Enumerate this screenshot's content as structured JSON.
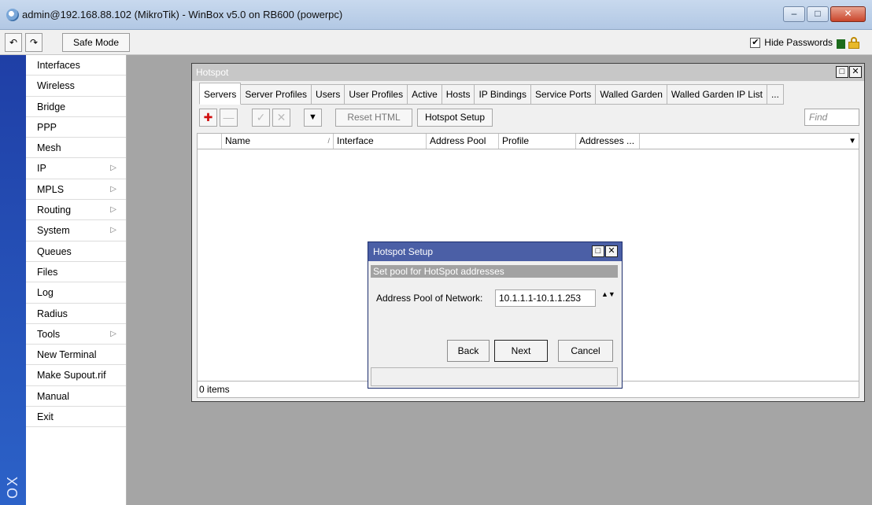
{
  "window": {
    "title": "admin@192.168.88.102 (MikroTik) - WinBox v5.0 on RB600 (powerpc)",
    "controls": {
      "minimize": "–",
      "maximize": "□",
      "close": "✕"
    }
  },
  "toolbar": {
    "undo_icon": "↶",
    "redo_icon": "↷",
    "safe_mode_label": "Safe Mode",
    "hide_passwords_label": "Hide Passwords",
    "hide_passwords_checked": "✔"
  },
  "strip": {
    "label": "OX"
  },
  "menu": {
    "items": [
      {
        "label": "Interfaces",
        "arrow": ""
      },
      {
        "label": "Wireless",
        "arrow": ""
      },
      {
        "label": "Bridge",
        "arrow": ""
      },
      {
        "label": "PPP",
        "arrow": ""
      },
      {
        "label": "Mesh",
        "arrow": ""
      },
      {
        "label": "IP",
        "arrow": "▷"
      },
      {
        "label": "MPLS",
        "arrow": "▷"
      },
      {
        "label": "Routing",
        "arrow": "▷"
      },
      {
        "label": "System",
        "arrow": "▷"
      },
      {
        "label": "Queues",
        "arrow": ""
      },
      {
        "label": "Files",
        "arrow": ""
      },
      {
        "label": "Log",
        "arrow": ""
      },
      {
        "label": "Radius",
        "arrow": ""
      },
      {
        "label": "Tools",
        "arrow": "▷"
      },
      {
        "label": "New Terminal",
        "arrow": ""
      },
      {
        "label": "Make Supout.rif",
        "arrow": ""
      },
      {
        "label": "Manual",
        "arrow": ""
      },
      {
        "label": "Exit",
        "arrow": ""
      }
    ]
  },
  "hotspot": {
    "title": "Hotspot",
    "tabs": [
      "Servers",
      "Server Profiles",
      "Users",
      "User Profiles",
      "Active",
      "Hosts",
      "IP Bindings",
      "Service Ports",
      "Walled Garden",
      "Walled Garden IP List",
      "..."
    ],
    "active_tab": "Servers",
    "toolbar": {
      "add_icon": "✚",
      "remove_icon": "—",
      "enable_icon": "✓",
      "disable_icon": "✕",
      "filter_icon": "▼",
      "reset_html_label": "Reset HTML",
      "hotspot_setup_label": "Hotspot Setup",
      "find_placeholder": "Find"
    },
    "table": {
      "columns": [
        "Name",
        "Interface",
        "Address Pool",
        "Profile",
        "Addresses ..."
      ],
      "sort_indicator": "/",
      "dropdown_arrow": "▼",
      "rows": []
    },
    "status": "0 items"
  },
  "setup_dialog": {
    "title": "Hotspot Setup",
    "header": "Set pool for HotSpot addresses",
    "field_label": "Address Pool of Network:",
    "field_value": "10.1.1.1-10.1.1.253",
    "spinner": "▲▼",
    "buttons": {
      "back": "Back",
      "next": "Next",
      "cancel": "Cancel"
    }
  }
}
